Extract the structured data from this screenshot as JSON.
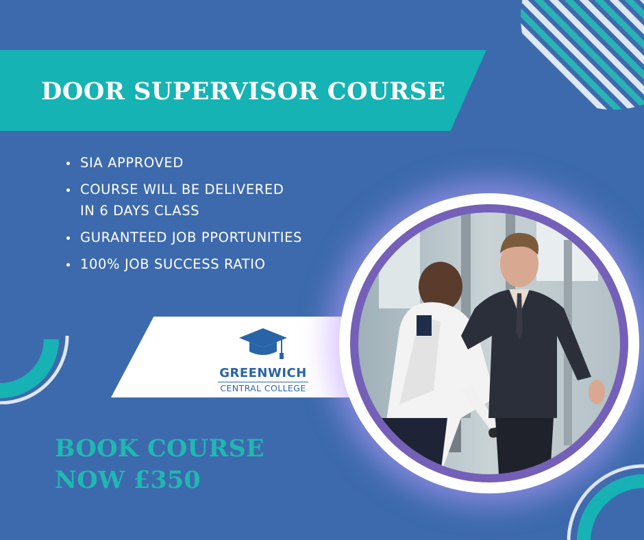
{
  "title": "DOOR SUPERVISOR COURSE",
  "features": [
    {
      "lines": [
        "SIA APPROVED"
      ]
    },
    {
      "lines": [
        "COURSE WILL BE DELIVERED",
        "IN 6 DAYS CLASS"
      ]
    },
    {
      "lines": [
        "GURANTEED JOB PPORTUNITIES"
      ]
    },
    {
      "lines": [
        "100% JOB SUCCESS RATIO"
      ]
    }
  ],
  "logo": {
    "name": "GREENWICH",
    "subtitle": "CENTRAL COLLEGE",
    "icon": "graduation-cap-icon"
  },
  "cta": {
    "line1": "BOOK COURSE",
    "line2": "NOW £350"
  },
  "colors": {
    "background": "#3d6aad",
    "teal": "#15b3b3",
    "cta_text": "#1fb8b2",
    "white": "#ffffff",
    "logo_blue": "#2a64a8",
    "ring_glow": "#b8a0ff"
  },
  "photo": {
    "icon": "security-screening-photo"
  }
}
